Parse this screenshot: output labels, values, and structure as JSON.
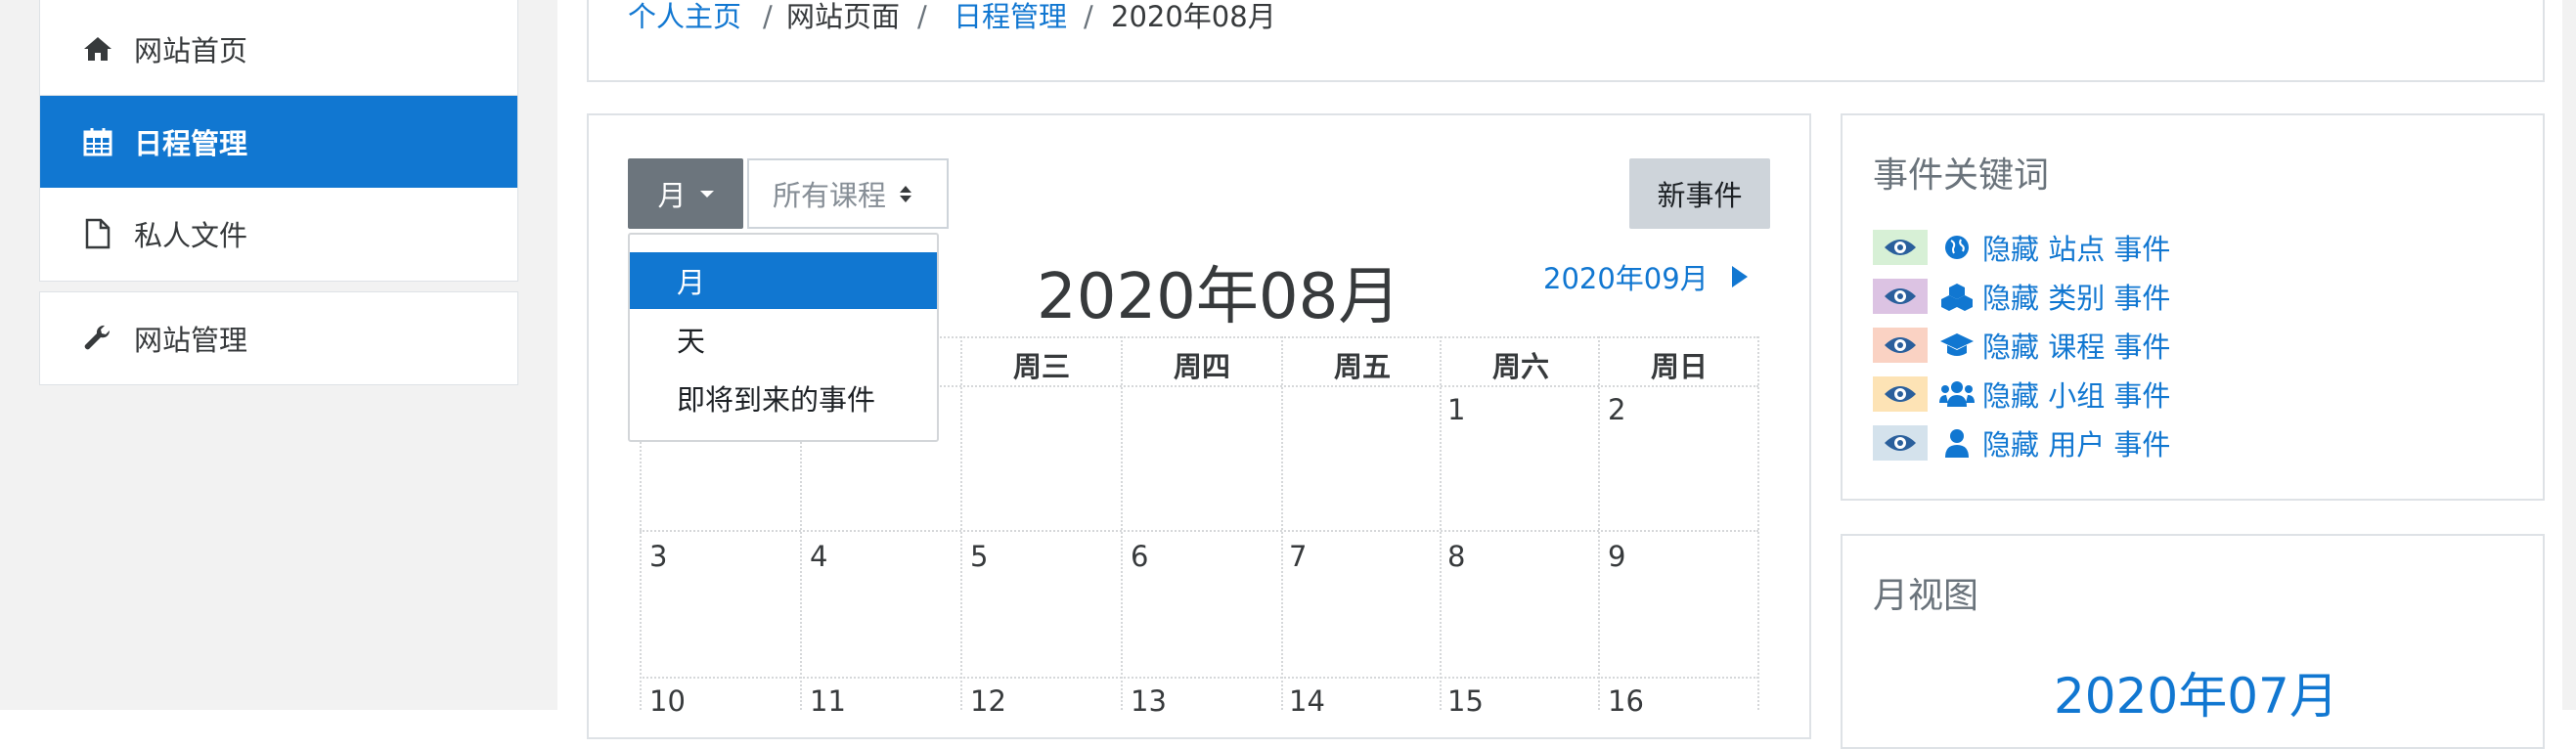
{
  "sidebar": {
    "items": [
      {
        "label": "网站首页",
        "icon": "home-icon"
      },
      {
        "label": "日程管理",
        "icon": "calendar-icon",
        "active": true
      },
      {
        "label": "私人文件",
        "icon": "file-icon"
      }
    ],
    "admin": {
      "label": "网站管理",
      "icon": "wrench-icon"
    }
  },
  "breadcrumb": {
    "items": [
      "个人主页",
      "网站页面",
      "日程管理",
      "2020年08月"
    ],
    "separator": "/"
  },
  "toolbar": {
    "view_button": "月",
    "course_select": "所有课程",
    "new_event_button": "新事件"
  },
  "view_dropdown": {
    "options": [
      "月",
      "天",
      "即将到来的事件"
    ],
    "selected": "月"
  },
  "calendar": {
    "title": "2020年08月",
    "next_link": "2020年09月",
    "weekdays": [
      "周三",
      "周四",
      "周五",
      "周六",
      "周日"
    ],
    "week1": [
      "",
      "",
      "",
      "",
      "",
      "1",
      "2"
    ],
    "week2": [
      "3",
      "4",
      "5",
      "6",
      "7",
      "8",
      "9"
    ],
    "week3": [
      "10",
      "11",
      "12",
      "13",
      "14",
      "15",
      "16"
    ]
  },
  "event_keys": {
    "title": "事件关键词",
    "items": [
      {
        "text": "隐藏 站点 事件",
        "icon": "globe-icon",
        "swatch": "#d7f0d6"
      },
      {
        "text": "隐藏 类别 事件",
        "icon": "cubes-icon",
        "swatch": "#dcc3e3"
      },
      {
        "text": "隐藏 课程 事件",
        "icon": "graduation-cap-icon",
        "swatch": "#fad2c3"
      },
      {
        "text": "隐藏 小组 事件",
        "icon": "users-icon",
        "swatch": "#fde3b5"
      },
      {
        "text": "隐藏 用户 事件",
        "icon": "user-icon",
        "swatch": "#d4e2ec"
      }
    ]
  },
  "mini_calendar": {
    "title": "月视图",
    "month": "2020年07月"
  },
  "colors": {
    "accent": "#1177d1",
    "secondary_button": "#6c757d"
  }
}
